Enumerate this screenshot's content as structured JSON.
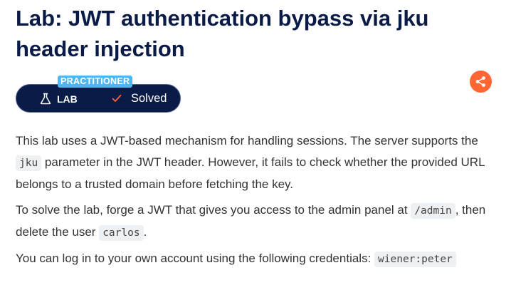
{
  "lab": {
    "title": "Lab: JWT authentication bypass via jku header injection",
    "level": "PRACTITIONER",
    "type_label": "LAB",
    "status": "Solved"
  },
  "icons": {
    "lab": "flask-icon",
    "status": "checkmark-icon",
    "share": "share-icon"
  },
  "colors": {
    "title": "#0a1b47",
    "badge_bg": "#0a1b47",
    "level_bg": "#4fb6f0",
    "check": "#ff6633",
    "share_bg": "#ff6633"
  },
  "description": {
    "p1_before": "This lab uses a JWT-based mechanism for handling sessions. The server supports the ",
    "p1_code": "jku",
    "p1_after": " parameter in the JWT header. However, it fails to check whether the provided URL belongs to a trusted domain before fetching the key.",
    "p2_before": "To solve the lab, forge a JWT that gives you access to the admin panel at ",
    "p2_code1": "/admin",
    "p2_middle": ", then delete the user ",
    "p2_code2": "carlos",
    "p2_after": ".",
    "p3_text": "You can log in to your own account using the following credentials: ",
    "p3_code": "wiener:peter"
  }
}
